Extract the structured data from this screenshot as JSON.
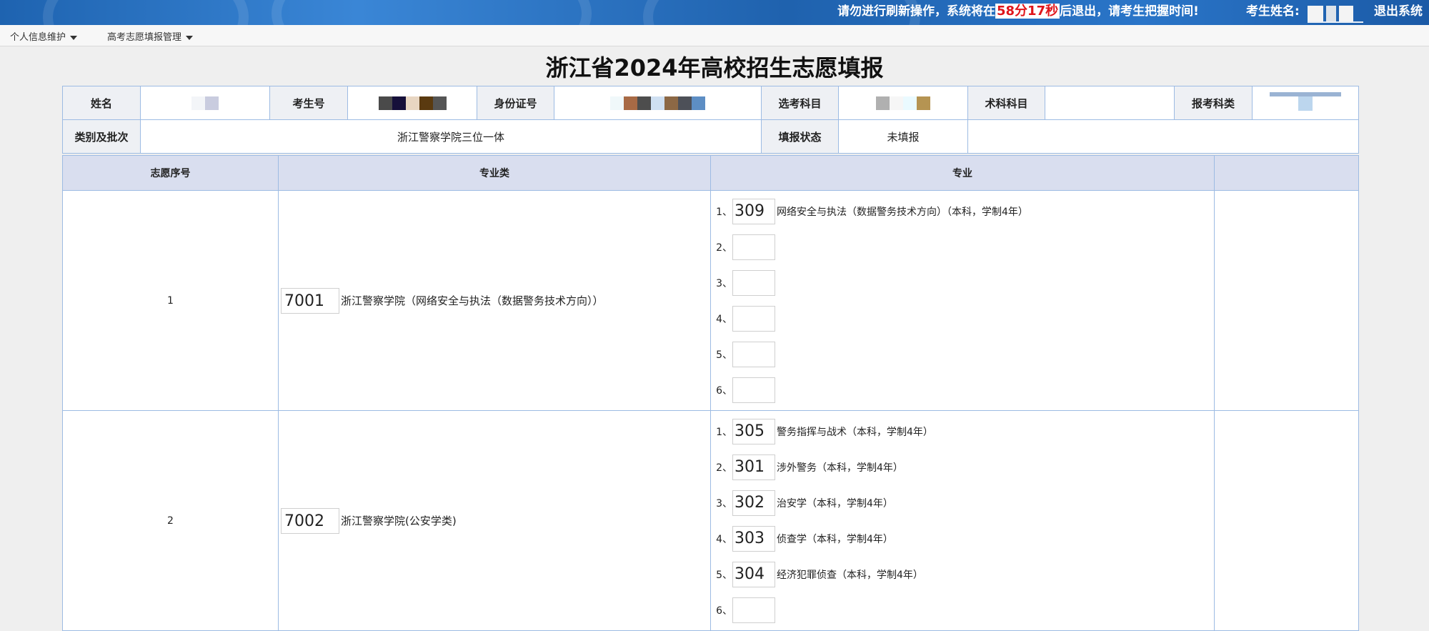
{
  "header": {
    "notice_before": "请勿进行刷新操作，系统将在",
    "notice_time": "58分17秒",
    "notice_after": "后退出，请考生把握时间!",
    "candidate_label": "考生姓名:",
    "logout": "退出系统"
  },
  "menu": [
    {
      "label": "个人信息维护"
    },
    {
      "label": "高考志愿填报管理"
    }
  ],
  "title": "浙江省2024年高校招生志愿填报",
  "info": {
    "name_label": "姓名",
    "exam_no_label": "考生号",
    "id_label": "身份证号",
    "subjects_label": "选考科目",
    "skill_label": "术科科目",
    "category_label": "报考科类",
    "batch_label": "类别及批次",
    "batch_value": "浙江警察学院三位一体",
    "status_label": "填报状态",
    "status_value": "未填报"
  },
  "table": {
    "headers": [
      "志愿序号",
      "专业类",
      "专业",
      ""
    ],
    "rows": [
      {
        "seq": "1",
        "code": "7001",
        "category": "浙江警察学院（网络安全与执法（数据警务技术方向））",
        "majors": [
          {
            "num": "1、",
            "code": "309",
            "text": "网络安全与执法（数据警务技术方向）（本科，学制4年）"
          },
          {
            "num": "2、",
            "code": "",
            "text": ""
          },
          {
            "num": "3、",
            "code": "",
            "text": ""
          },
          {
            "num": "4、",
            "code": "",
            "text": ""
          },
          {
            "num": "5、",
            "code": "",
            "text": ""
          },
          {
            "num": "6、",
            "code": "",
            "text": ""
          }
        ]
      },
      {
        "seq": "2",
        "code": "7002",
        "category": "浙江警察学院(公安学类)",
        "majors": [
          {
            "num": "1、",
            "code": "305",
            "text": "警务指挥与战术（本科，学制4年）"
          },
          {
            "num": "2、",
            "code": "301",
            "text": "涉外警务（本科，学制4年）"
          },
          {
            "num": "3、",
            "code": "302",
            "text": "治安学（本科，学制4年）"
          },
          {
            "num": "4、",
            "code": "303",
            "text": "侦查学（本科，学制4年）"
          },
          {
            "num": "5、",
            "code": "304",
            "text": "经济犯罪侦查（本科，学制4年）"
          },
          {
            "num": "6、",
            "code": "",
            "text": ""
          }
        ]
      }
    ]
  },
  "colors": {
    "banner": "#1f62ae",
    "countdown": "#e0151b",
    "header_bg": "#d9deef",
    "border": "#9dbbe3",
    "label_bg": "#eef0f4"
  }
}
